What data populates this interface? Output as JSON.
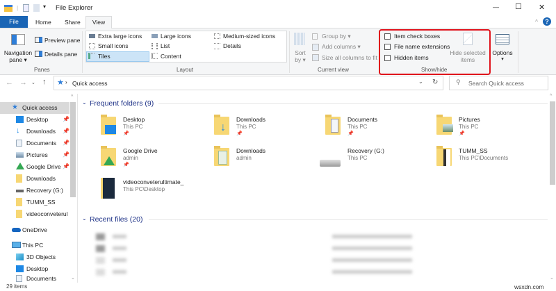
{
  "window": {
    "title": "File Explorer",
    "minimize": "—",
    "maximize": "☐",
    "close": "✕",
    "help": "?"
  },
  "tabs": [
    {
      "label": "File"
    },
    {
      "label": "Home"
    },
    {
      "label": "Share"
    },
    {
      "label": "View"
    }
  ],
  "ribbon": {
    "panes": {
      "label": "Panes",
      "navigation_pane": "Navigation",
      "navigation_pane2": "pane ▾",
      "preview_pane": "Preview pane",
      "details_pane": "Details pane"
    },
    "layout": {
      "label": "Layout",
      "items": [
        "Extra large icons",
        "Large icons",
        "Medium-sized icons",
        "Small icons",
        "List",
        "Details",
        "Tiles",
        "Content"
      ],
      "selected": "Tiles"
    },
    "current_view": {
      "label": "Current view",
      "sort_by": "Sort",
      "sort_by2": "by ▾",
      "group_by": "Group by ▾",
      "add_columns": "Add columns ▾",
      "size_all": "Size all columns to fit"
    },
    "show_hide": {
      "label": "Show/hide",
      "item_check_boxes": "Item check boxes",
      "file_name_extensions": "File name extensions",
      "hidden_items": "Hidden items",
      "hide_selected": "Hide selected",
      "hide_selected2": "items",
      "highlight_color": "#e0121b"
    },
    "options": {
      "label": "Options",
      "arrow": "▾"
    }
  },
  "address": {
    "path": "Quick access",
    "search_placeholder": "Search Quick access"
  },
  "sidebar": {
    "items": [
      "Quick access",
      "Desktop",
      "Downloads",
      "Documents",
      "Pictures",
      "Google Drive",
      "Downloads",
      "Recovery (G:)",
      "TUMM_SS",
      "videoconveterul",
      "OneDrive",
      "This PC",
      "3D Objects",
      "Desktop",
      "Documents"
    ]
  },
  "frequent": {
    "header": "Frequent folders (9)",
    "items": [
      {
        "name": "Desktop",
        "sub": "This PC"
      },
      {
        "name": "Downloads",
        "sub": "This PC"
      },
      {
        "name": "Documents",
        "sub": "This PC"
      },
      {
        "name": "Pictures",
        "sub": "This PC"
      },
      {
        "name": "Google Drive",
        "sub": "admin"
      },
      {
        "name": "Downloads",
        "sub": "admin"
      },
      {
        "name": "Recovery (G:)",
        "sub": "This PC"
      },
      {
        "name": "TUMM_SS",
        "sub": "This PC\\Documents"
      },
      {
        "name": "videoconveterultimate_",
        "sub": "This PC\\Desktop"
      }
    ]
  },
  "recent": {
    "header": "Recent files (20)"
  },
  "status": {
    "count": "29 items"
  },
  "watermark": "wsxdn.com"
}
